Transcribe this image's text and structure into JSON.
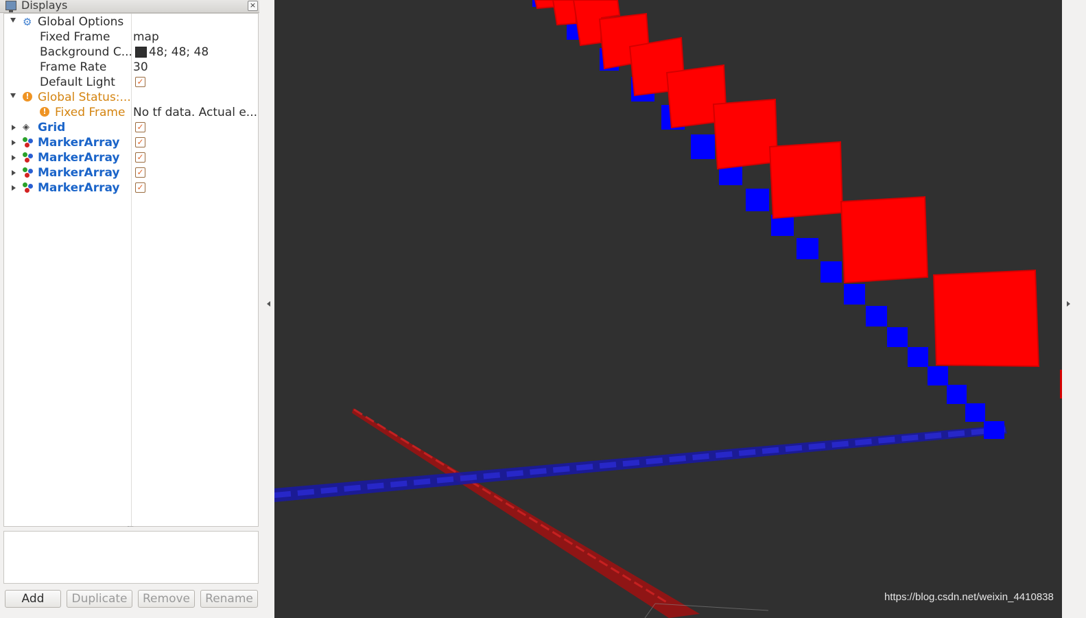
{
  "panel": {
    "title": "Displays",
    "rows": [
      {
        "name": "Global Options",
        "value": ""
      },
      {
        "name": "Fixed Frame",
        "value": "map"
      },
      {
        "name": "Background C...",
        "value": "48; 48; 48"
      },
      {
        "name": "Frame Rate",
        "value": "30"
      },
      {
        "name": "Default Light",
        "value": ""
      },
      {
        "name": "Global Status:...",
        "value": ""
      },
      {
        "name": "Fixed Frame",
        "value": "No tf data.  Actual e..."
      },
      {
        "name": "Grid",
        "value": ""
      },
      {
        "name": "MarkerArray",
        "value": ""
      },
      {
        "name": "MarkerArray",
        "value": ""
      },
      {
        "name": "MarkerArray",
        "value": ""
      },
      {
        "name": "MarkerArray",
        "value": ""
      }
    ]
  },
  "buttons": {
    "add": "Add",
    "duplicate": "Duplicate",
    "remove": "Remove",
    "rename": "Rename"
  },
  "watermark": "https://blog.csdn.net/weixin_4410838",
  "colors": {
    "background": "#303030",
    "marker_red": "#ff0000",
    "marker_blue": "#0000ff",
    "link_blue": "#1a64c9",
    "warning_orange": "#d48410"
  }
}
